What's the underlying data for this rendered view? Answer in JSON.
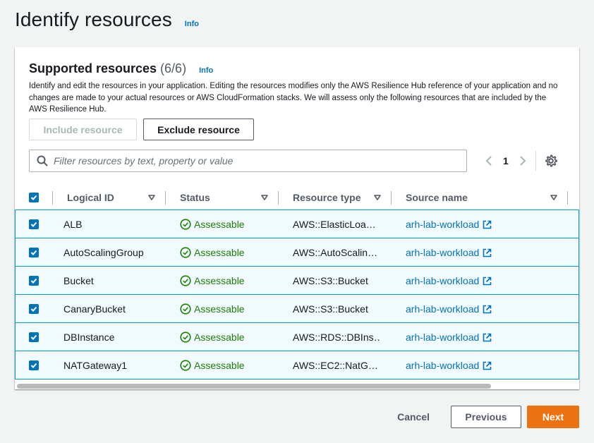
{
  "page": {
    "title": "Identify resources",
    "info_label": "Info"
  },
  "section": {
    "title": "Supported resources",
    "count": "(6/6)",
    "info_label": "Info",
    "description": "Identify and edit the resources in your application. Editing the resources modifies only the AWS Resilience Hub reference of your application and no changes are made to your actual resources or AWS CloudFormation stacks. We will assess only the following resources that are included by the AWS Resilience Hub."
  },
  "actions": {
    "include_label": "Include resource",
    "exclude_label": "Exclude resource"
  },
  "search": {
    "placeholder": "Filter resources by text, property or value",
    "icon": "search-icon"
  },
  "pagination": {
    "current_page": "1"
  },
  "table": {
    "columns": [
      "Logical ID",
      "Status",
      "Resource type",
      "Source name"
    ],
    "rows": [
      {
        "logical_id": "ALB",
        "status": "Assessable",
        "resource_type": "AWS::ElasticLoa…",
        "source_name": "arh-lab-workload"
      },
      {
        "logical_id": "AutoScalingGroup",
        "status": "Assessable",
        "resource_type": "AWS::AutoScalin…",
        "source_name": "arh-lab-workload"
      },
      {
        "logical_id": "Bucket",
        "status": "Assessable",
        "resource_type": "AWS::S3::Bucket",
        "source_name": "arh-lab-workload"
      },
      {
        "logical_id": "CanaryBucket",
        "status": "Assessable",
        "resource_type": "AWS::S3::Bucket",
        "source_name": "arh-lab-workload"
      },
      {
        "logical_id": "DBInstance",
        "status": "Assessable",
        "resource_type": "AWS::RDS::DBIns…",
        "source_name": "arh-lab-workload"
      },
      {
        "logical_id": "NATGateway1",
        "status": "Assessable",
        "resource_type": "AWS::EC2::NatG…",
        "source_name": "arh-lab-workload"
      }
    ]
  },
  "footer": {
    "cancel_label": "Cancel",
    "previous_label": "Previous",
    "next_label": "Next"
  },
  "colors": {
    "primary": "#ec7211",
    "link": "#0073bb",
    "success": "#1d8102",
    "selected_row": "#f1faff",
    "selected_border": "#00a1c9"
  }
}
